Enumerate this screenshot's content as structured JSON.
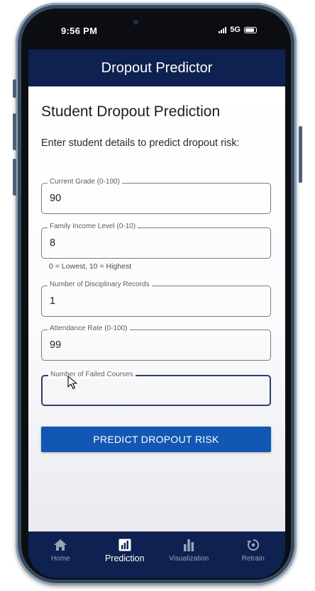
{
  "status_bar": {
    "time": "9:56 PM",
    "network": "5G"
  },
  "app_bar": {
    "title": "Dropout Predictor"
  },
  "page": {
    "heading": "Student Dropout Prediction",
    "subheading": "Enter student details to predict dropout risk:"
  },
  "form": {
    "fields": [
      {
        "label": "Current Grade (0-100)",
        "value": "90"
      },
      {
        "label": "Family Income Level (0-10)",
        "value": "8",
        "helper": "0 = Lowest, 10 = Highest"
      },
      {
        "label": "Number of Disciplinary Records",
        "value": "1"
      },
      {
        "label": "Attendance Rate (0-100)",
        "value": "99"
      },
      {
        "label": "Number of Failed Courses",
        "value": ""
      }
    ],
    "submit_label": "PREDICT DROPOUT RISK"
  },
  "bottom_nav": {
    "items": [
      {
        "label": "Home",
        "icon": "home-icon"
      },
      {
        "label": "Prediction",
        "icon": "prediction-icon",
        "active": true
      },
      {
        "label": "Visualization",
        "icon": "bar-chart-icon"
      },
      {
        "label": "Retrain",
        "icon": "retrain-icon"
      }
    ]
  },
  "colors": {
    "app_bar": "#0e2150",
    "primary_button": "#1257b3",
    "nav_active": "#ffffff",
    "nav_inactive": "#9aa4b8"
  }
}
